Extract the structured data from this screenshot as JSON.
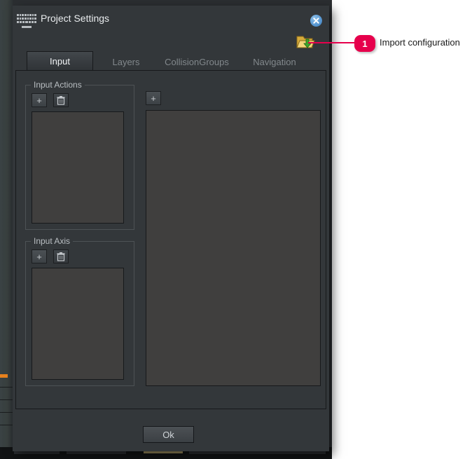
{
  "window": {
    "title": "Project Settings",
    "icon": "keyboard-icon",
    "close_label": "×"
  },
  "toolbar": {
    "import_icon": "import-folder-icon",
    "import_tooltip": "Import configuration"
  },
  "tabs": [
    {
      "label": "Input",
      "active": true
    },
    {
      "label": "Layers",
      "active": false
    },
    {
      "label": "CollisionGroups",
      "active": false
    },
    {
      "label": "Navigation",
      "active": false
    }
  ],
  "input_tab": {
    "input_actions": {
      "title": "Input Actions",
      "add_label": "+",
      "delete_icon": "trash-icon",
      "items": []
    },
    "input_axis": {
      "title": "Input Axis",
      "add_label": "+",
      "delete_icon": "trash-icon",
      "items": []
    },
    "bindings": {
      "add_label": "+",
      "items": []
    }
  },
  "footer": {
    "ok_label": "Ok"
  },
  "annotation": {
    "number": "1",
    "text": "Import configuration",
    "color": "#e6004c"
  },
  "colors": {
    "dialog_bg": "#33373a",
    "panel_bg": "#403F3E",
    "border": "#17191b",
    "accent": "#e6004c",
    "orange_marker": "#e8821e",
    "tan_strip": "#9d8f5f"
  }
}
